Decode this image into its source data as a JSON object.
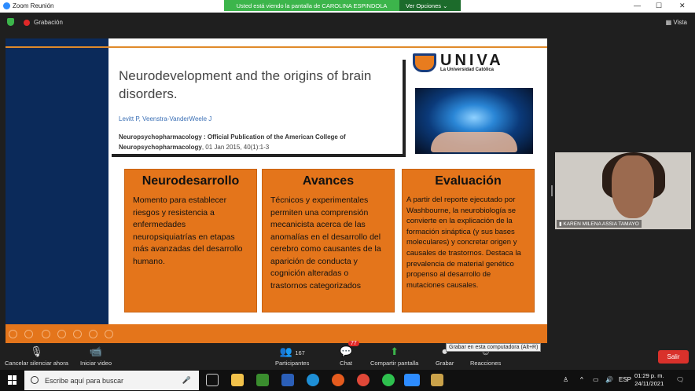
{
  "window": {
    "title": "Zoom Reunión",
    "min": "—",
    "max": "☐",
    "close": "✕"
  },
  "banner": {
    "message": "Usted está viendo la pantalla de CAROLINA ESPINDOLA",
    "options": "Ver Opciones",
    "chevron": "⌄"
  },
  "topbar": {
    "recording": "Grabación",
    "view": "Vista"
  },
  "slide": {
    "paper_title": "Neurodevelopment and the origins of brain disorders.",
    "authors": "Levitt P, Veenstra-VanderWeele J",
    "journal_bold": "Neuropsychopharmacology : Official Publication of the American College of Neuropsychopharmacology",
    "journal_rest": ", 01 Jan 2015, 40(1):1-3",
    "logo_name": "UNIVA",
    "logo_sub": "La Universidad Católica",
    "cards": [
      {
        "title": "Neurodesarrollo",
        "body": "Momento para establecer riesgos y resistencia a enfermedades neuropsiquiatrías en etapas más avanzadas del desarrollo humano."
      },
      {
        "title": "Avances",
        "body": "Técnicos y experimentales permiten una comprensión mecanicista acerca de las anomalías en el desarrollo del cerebro como causantes de la aparición de conducta y cognición alteradas o trastornos categorizados"
      },
      {
        "title": "Evaluación",
        "body": "A partir del reporte ejecutado por Washbourne, la neurobiología se convierte en la explicación de la formación sináptica (y sus bases moleculares) y concretar origen y causales de trastornos. Destaca la prevalencia de material genético propenso al desarrollo de mutaciones causales."
      }
    ]
  },
  "video": {
    "participant": "KAREN MILENA ASSIA TAMAYO"
  },
  "toolbar": {
    "mute": "Cancelar silenciar ahora",
    "video": "Iniciar video",
    "participants": "Participantes",
    "participants_count": "167",
    "chat": "Chat",
    "chat_badge": "77",
    "share": "Compartir pantalla",
    "record": "Grabar",
    "reactions": "Reacciones",
    "tooltip": "Grabar en esta computadora (Alt+R)",
    "leave": "Salir"
  },
  "taskbar": {
    "search": "Escribe aquí para buscar",
    "lang": "ESP",
    "time": "01:29 p. m.",
    "date": "24/11/2021"
  },
  "colors": {
    "accent": "#e4751b",
    "zoom_green": "#3cb54b",
    "leave_red": "#d9312b",
    "slide_blue": "#0b2a5a"
  }
}
